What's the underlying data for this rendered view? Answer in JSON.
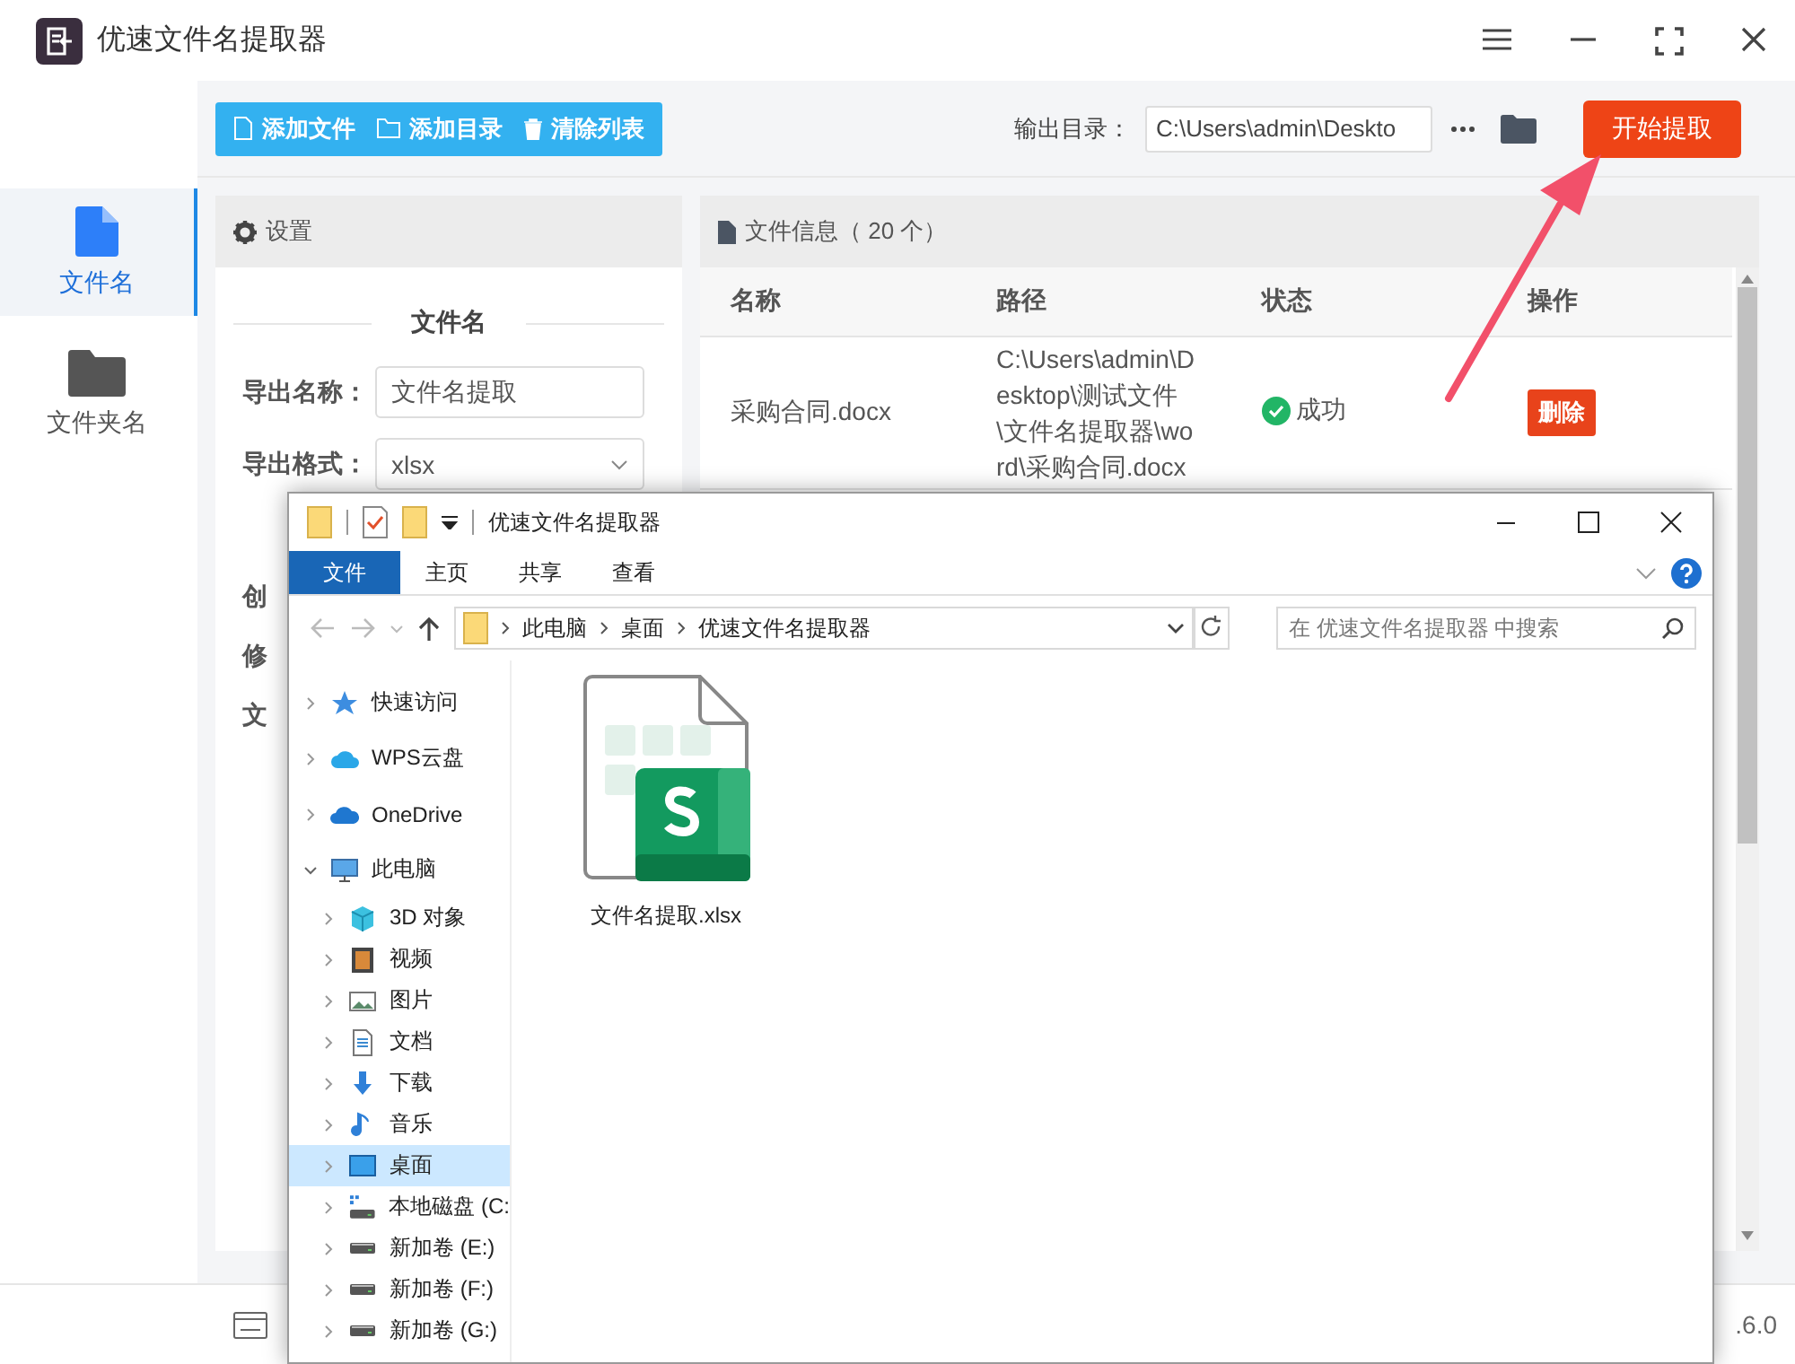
{
  "window": {
    "title": "优速文件名提取器"
  },
  "nav": [
    {
      "label": "文件名",
      "kind": "file",
      "selected": true
    },
    {
      "label": "文件夹名",
      "kind": "folder",
      "selected": false
    }
  ],
  "toolbar": {
    "buttons": [
      {
        "label": "添加文件",
        "kind": "file"
      },
      {
        "label": "添加目录",
        "kind": "folder"
      },
      {
        "label": "清除列表",
        "kind": "trash"
      }
    ],
    "output_label": "输出目录：",
    "output_path": "C:\\Users\\admin\\Deskto",
    "start_button": "开始提取"
  },
  "settings": {
    "title": "设置",
    "section": "文件名",
    "fields": [
      {
        "label": "导出名称：",
        "kind": "input",
        "value": "文件名提取"
      },
      {
        "label": "导出格式：",
        "kind": "select",
        "value": "xlsx"
      }
    ],
    "more_labels": [
      "创",
      "修",
      "文"
    ]
  },
  "files": {
    "title": "文件信息（ 20 个）",
    "columns": [
      "名称",
      "路径",
      "状态",
      "操作"
    ],
    "rows": [
      {
        "name": "采购合同.docx",
        "path": "C:\\Users\\admin\\Desktop\\测试文件\\文件名提取器\\word\\采购合同.docx",
        "status": "成功",
        "success": true,
        "action": "删除"
      }
    ]
  },
  "status_bar": {
    "right": ".6.0"
  },
  "explorer": {
    "title": "优速文件名提取器",
    "tabs": [
      {
        "label": "文件",
        "selected": true
      },
      {
        "label": "主页",
        "selected": false
      },
      {
        "label": "共享",
        "selected": false
      },
      {
        "label": "查看",
        "selected": false
      }
    ],
    "breadcrumbs": [
      "此电脑",
      "桌面",
      "优速文件名提取器"
    ],
    "search": {
      "placeholder": "在 优速文件名提取器 中搜索"
    },
    "tree": [
      {
        "label": "快速访问",
        "kind": "star",
        "expanded": false,
        "selected": false
      },
      {
        "label": "WPS云盘",
        "kind": "cloud",
        "expanded": false,
        "selected": false
      },
      {
        "label": "OneDrive",
        "kind": "onedrive",
        "expanded": false,
        "selected": false
      },
      {
        "label": "此电脑",
        "kind": "pc",
        "expanded": true,
        "selected": false,
        "children": [
          {
            "label": "3D 对象",
            "kind": "cube",
            "expanded": false,
            "selected": false
          },
          {
            "label": "视频",
            "kind": "video",
            "expanded": false,
            "selected": false
          },
          {
            "label": "图片",
            "kind": "image",
            "expanded": false,
            "selected": false
          },
          {
            "label": "文档",
            "kind": "doc",
            "expanded": false,
            "selected": false
          },
          {
            "label": "下载",
            "kind": "download",
            "expanded": false,
            "selected": false
          },
          {
            "label": "音乐",
            "kind": "music",
            "expanded": false,
            "selected": false
          },
          {
            "label": "桌面",
            "kind": "desktop",
            "expanded": false,
            "selected": true
          },
          {
            "label": "本地磁盘 (C:",
            "kind": "windisk",
            "expanded": false,
            "selected": false
          },
          {
            "label": "新加卷 (E:)",
            "kind": "disk",
            "expanded": false,
            "selected": false
          },
          {
            "label": "新加卷 (F:)",
            "kind": "disk",
            "expanded": false,
            "selected": false
          },
          {
            "label": "新加卷 (G:)",
            "kind": "disk",
            "expanded": false,
            "selected": false
          }
        ]
      }
    ],
    "files": [
      {
        "name": "文件名提取.xlsx",
        "kind": "sheet"
      }
    ]
  }
}
